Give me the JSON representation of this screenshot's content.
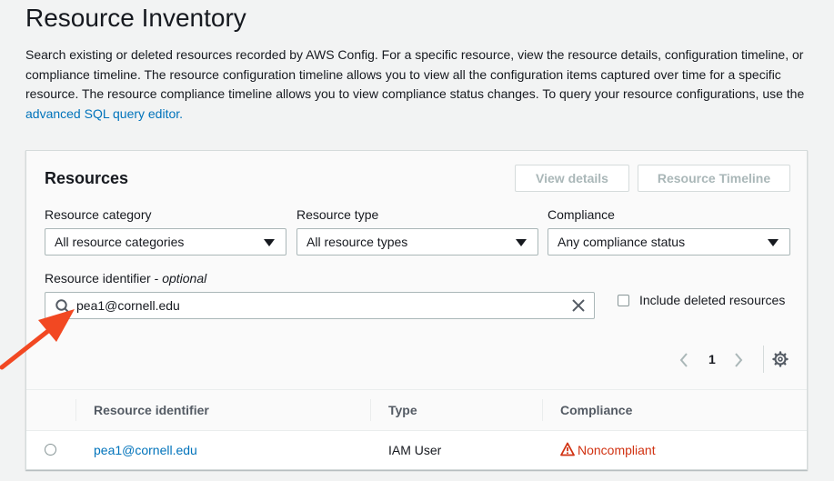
{
  "page": {
    "title": "Resource Inventory",
    "description": "Search existing or deleted resources recorded by AWS Config. For a specific resource, view the resource details, configuration timeline, or compliance timeline. The resource configuration timeline allows you to view all the configuration items captured over time for a specific resource. The resource compliance timeline allows you to view compliance status changes. To query your resource configurations, use the ",
    "description_link": "advanced SQL query editor."
  },
  "resources": {
    "title": "Resources",
    "view_details_label": "View details",
    "resource_timeline_label": "Resource Timeline",
    "filters": {
      "category_label": "Resource category",
      "category_value": "All resource categories",
      "type_label": "Resource type",
      "type_value": "All resource types",
      "compliance_label": "Compliance",
      "compliance_value": "Any compliance status"
    },
    "identifier_label": "Resource identifier",
    "identifier_optional": "optional",
    "identifier_value": "pea1@cornell.edu",
    "include_deleted_label": "Include deleted resources",
    "pagination": {
      "current_page": "1"
    },
    "table": {
      "columns": [
        "Resource identifier",
        "Type",
        "Compliance"
      ],
      "rows": [
        {
          "identifier": "pea1@cornell.edu",
          "type": "IAM User",
          "compliance": "Noncompliant"
        }
      ]
    }
  },
  "colors": {
    "link": "#0073bb",
    "noncompliant": "#d13212",
    "annotation_arrow": "#f24822"
  },
  "icons": [
    "search-icon",
    "clear-icon",
    "chevron-left-icon",
    "chevron-right-icon",
    "gear-icon",
    "warning-icon",
    "caret-down-icon"
  ]
}
